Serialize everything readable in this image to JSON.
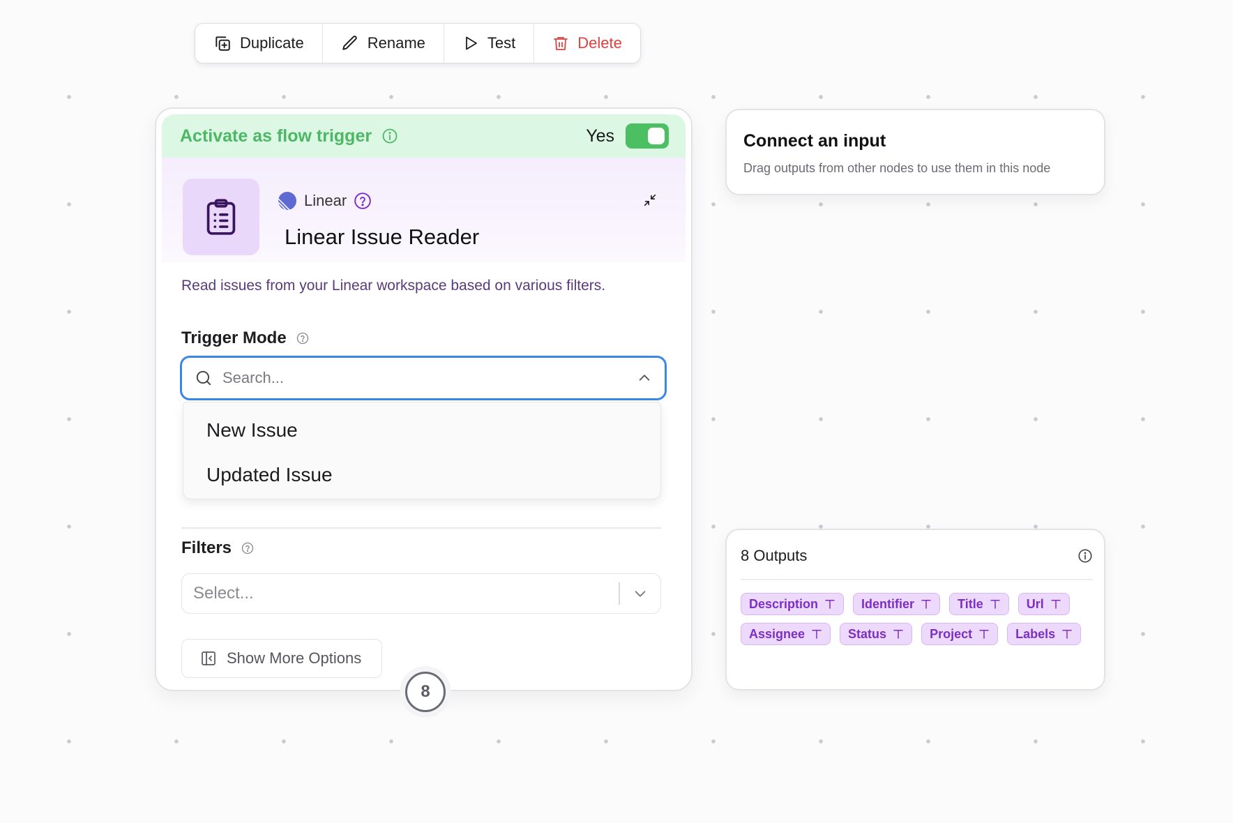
{
  "toolbar": {
    "duplicate": "Duplicate",
    "rename": "Rename",
    "test": "Test",
    "delete": "Delete"
  },
  "node": {
    "trigger_label": "Activate as flow trigger",
    "trigger_value": "Yes",
    "trigger_enabled": true,
    "provider": "Linear",
    "title": "Linear Issue Reader",
    "description": "Read issues from your Linear workspace based on various filters.",
    "trigger_mode": {
      "label": "Trigger Mode",
      "placeholder": "Search...",
      "options": [
        "New Issue",
        "Updated Issue"
      ]
    },
    "filters": {
      "label": "Filters",
      "placeholder": "Select..."
    },
    "show_more": "Show More Options",
    "output_count": "8"
  },
  "connect": {
    "title": "Connect an input",
    "subtitle": "Drag outputs from other nodes to use them in this node"
  },
  "outputs": {
    "title": "8 Outputs",
    "items": [
      "Description",
      "Identifier",
      "Title",
      "Url",
      "Assignee",
      "Status",
      "Project",
      "Labels"
    ]
  },
  "colors": {
    "accent": "#3b86e8",
    "trigger_green": "#4cb865",
    "danger": "#e0403f",
    "tag_purple": "#7b2fc7"
  }
}
